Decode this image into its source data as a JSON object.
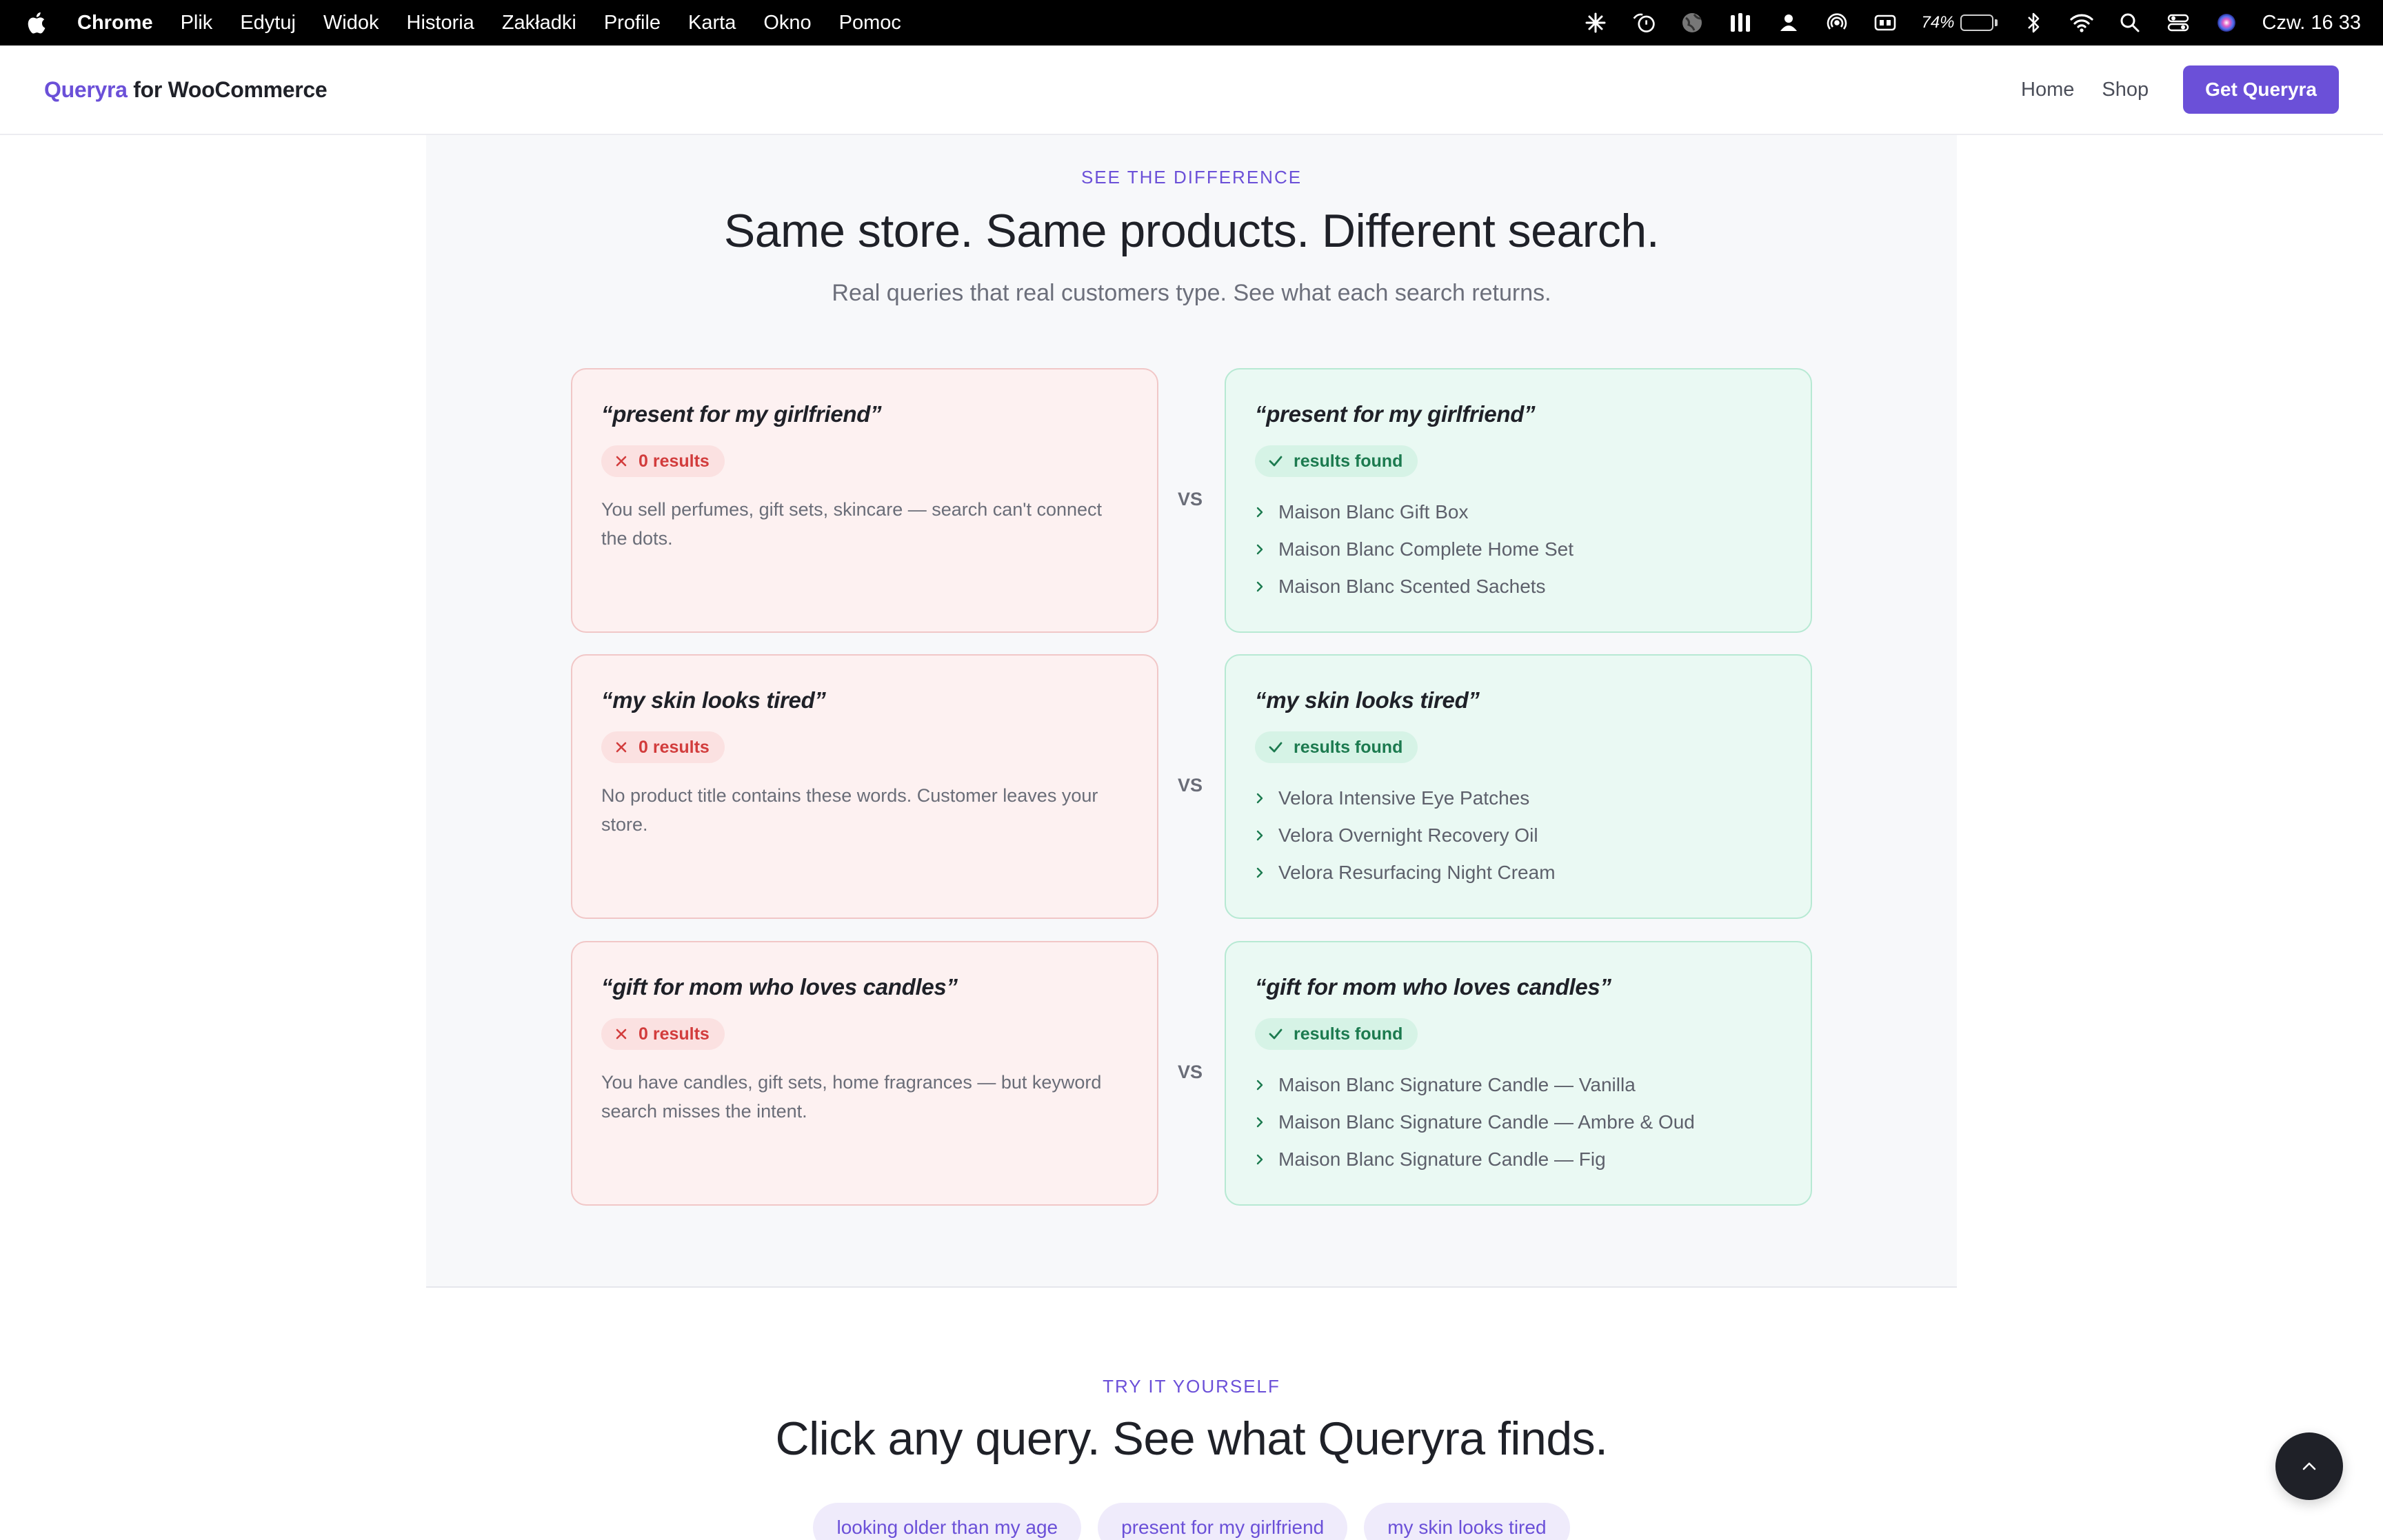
{
  "menubar": {
    "app": "Chrome",
    "menus": [
      "Plik",
      "Edytuj",
      "Widok",
      "Historia",
      "Zakładki",
      "Profile",
      "Karta",
      "Okno",
      "Pomoc"
    ],
    "battery": "74%",
    "battery_level": 0.74,
    "clock": "Czw. 16 33",
    "status_icons": [
      "sparkle-icon",
      "timer-icon",
      "globe-icon",
      "bars-icon",
      "user-icon",
      "airdrop-icon",
      "display-icon",
      "battery-icon",
      "bluetooth-icon",
      "wifi-icon",
      "search-icon",
      "control-center-icon",
      "siri-icon"
    ]
  },
  "header": {
    "brand_q": "Queryra",
    "brand_rest": " for WooCommerce",
    "nav": {
      "home": "Home",
      "shop": "Shop",
      "cta": "Get Queryra"
    }
  },
  "difference": {
    "eyebrow": "SEE THE DIFFERENCE",
    "title": "Same store. Same products. Different search.",
    "subtitle": "Real queries that real customers type. See what each search returns.",
    "vs": "VS",
    "rows": [
      {
        "bad": {
          "query": "“present for my girlfriend”",
          "badge": "0 results",
          "desc": "You sell perfumes, gift sets, skincare — search can't connect the dots."
        },
        "good": {
          "query": "“present for my girlfriend”",
          "badge": "results found",
          "items": [
            "Maison Blanc Gift Box",
            "Maison Blanc Complete Home Set",
            "Maison Blanc Scented Sachets"
          ]
        }
      },
      {
        "bad": {
          "query": "“my skin looks tired”",
          "badge": "0 results",
          "desc": "No product title contains these words. Customer leaves your store."
        },
        "good": {
          "query": "“my skin looks tired”",
          "badge": "results found",
          "items": [
            "Velora Intensive Eye Patches",
            "Velora Overnight Recovery Oil",
            "Velora Resurfacing Night Cream"
          ]
        }
      },
      {
        "bad": {
          "query": "“gift for mom who loves candles”",
          "badge": "0 results",
          "desc": "You have candles, gift sets, home fragrances — but keyword search misses the intent."
        },
        "good": {
          "query": "“gift for mom who loves candles”",
          "badge": "results found",
          "items": [
            "Maison Blanc Signature Candle — Vanilla",
            "Maison Blanc Signature Candle — Ambre & Oud",
            "Maison Blanc Signature Candle — Fig"
          ]
        }
      }
    ]
  },
  "try": {
    "eyebrow": "TRY IT YOURSELF",
    "title": "Click any query. See what Queryra finds.",
    "chips": [
      "looking older than my age",
      "present for my girlfriend",
      "my skin looks tired"
    ]
  },
  "colors": {
    "accent": "#6b50d8",
    "bad": "#d23c3c",
    "good": "#1c7a4f"
  }
}
